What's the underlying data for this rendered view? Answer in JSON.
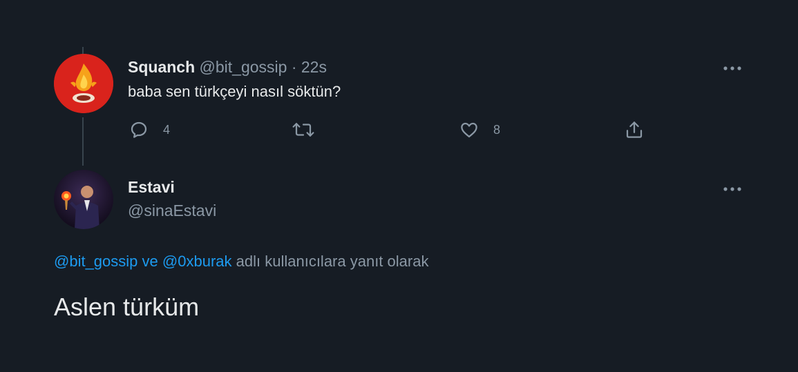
{
  "parent_tweet": {
    "display_name": "Squanch",
    "handle": "@bit_gossip",
    "separator": "·",
    "time": "22s",
    "text": "baba sen türkçeyi nasıl söktün?",
    "more_icon": "more-horizontal-icon",
    "actions": {
      "reply_count": "4",
      "like_count": "8"
    }
  },
  "main_tweet": {
    "display_name": "Estavi",
    "handle": "@sinaEstavi",
    "replying_to": {
      "user1": "@bit_gossip",
      "conjunction": "ve",
      "user2": "@0xburak",
      "suffix": "adlı kullanıcılara yanıt olarak"
    },
    "text": "Aslen türküm"
  },
  "colors": {
    "background": "#161c24",
    "text": "#e7e9ea",
    "muted": "#8b98a5",
    "link": "#1d9bf0",
    "avatar1": "#d9231c"
  }
}
